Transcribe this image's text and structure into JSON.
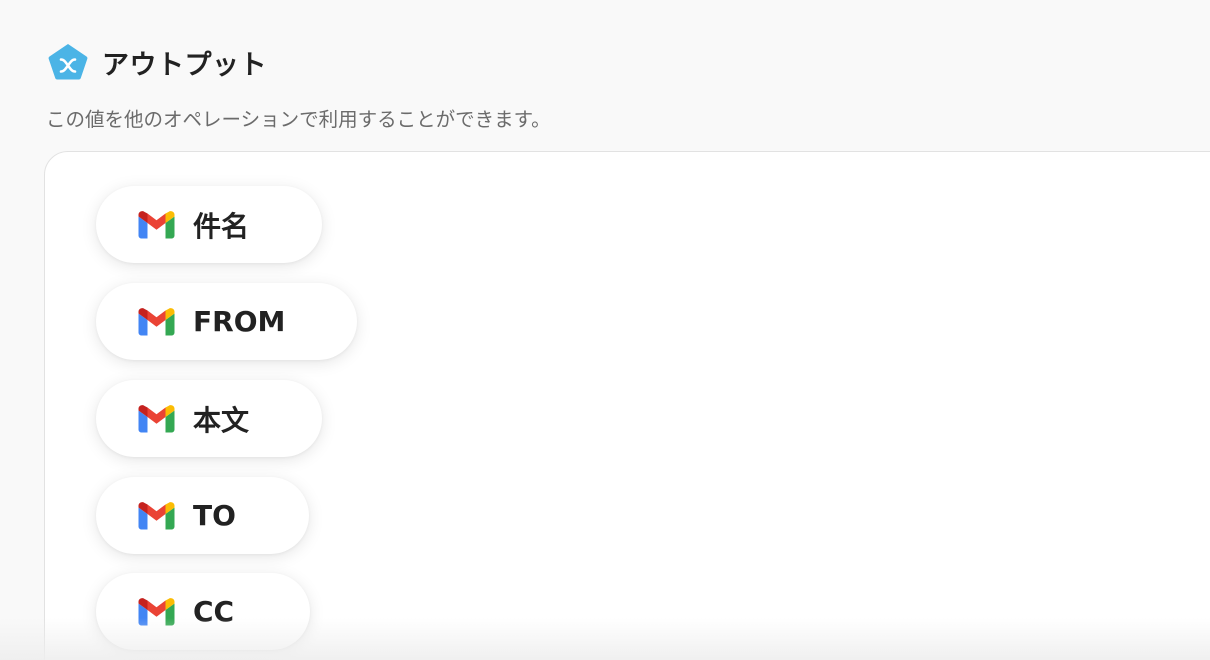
{
  "header": {
    "title": "アウトプット",
    "icon": "yoom-pentagon-icon",
    "icon_color": "#4bb4e6"
  },
  "subtitle": "この値を他のオペレーションで利用することができます。",
  "outputs": [
    {
      "label": "件名",
      "icon": "gmail-icon"
    },
    {
      "label": "FROM",
      "icon": "gmail-icon"
    },
    {
      "label": "本文",
      "icon": "gmail-icon"
    },
    {
      "label": "TO",
      "icon": "gmail-icon"
    },
    {
      "label": "CC",
      "icon": "gmail-icon"
    }
  ],
  "colors": {
    "gmail_red": "#ea4335",
    "gmail_blue": "#4285f4",
    "gmail_green": "#34a853",
    "gmail_yellow": "#fbbc04",
    "gmail_dark_red": "#c5221f"
  }
}
